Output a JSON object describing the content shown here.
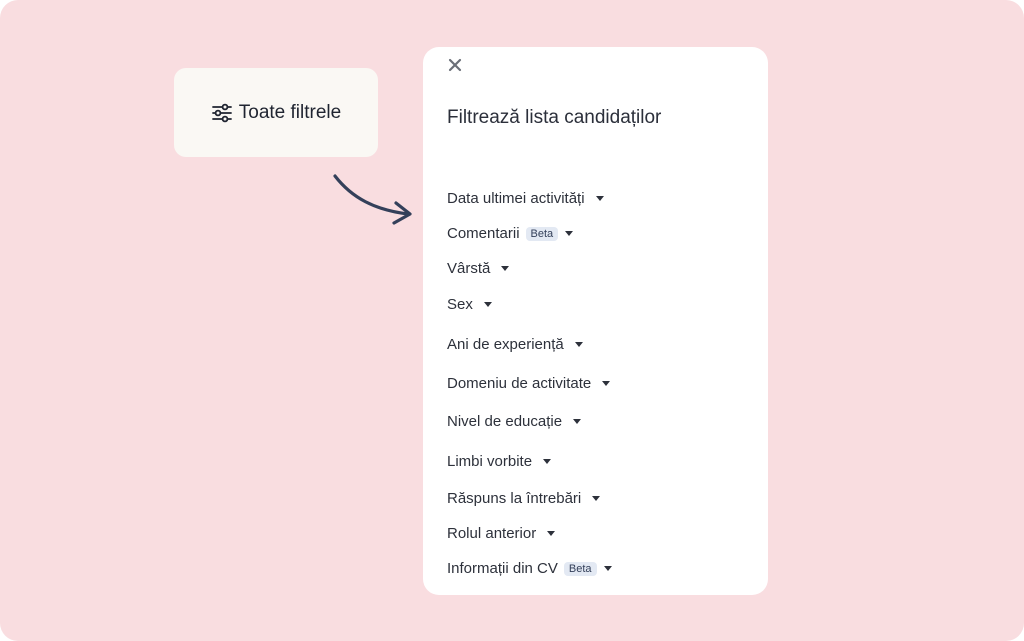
{
  "trigger": {
    "icon": "sliders-icon",
    "label": "Toate filtrele"
  },
  "panel": {
    "close_icon": "close-icon",
    "title": "Filtrează lista candidaților",
    "filters": [
      {
        "label": "Data ultimei activități",
        "badge": ""
      },
      {
        "label": "Comentarii",
        "badge": "Beta"
      },
      {
        "label": "Vârstă",
        "badge": ""
      },
      {
        "label": "Sex",
        "badge": ""
      },
      {
        "label": "Ani de experiență",
        "badge": ""
      },
      {
        "label": "Domeniu de activitate",
        "badge": ""
      },
      {
        "label": "Nivel de educație",
        "badge": ""
      },
      {
        "label": "Limbi vorbite",
        "badge": ""
      },
      {
        "label": "Răspuns la întrebări",
        "badge": ""
      },
      {
        "label": "Rolul anterior",
        "badge": ""
      },
      {
        "label": "Informații din CV",
        "badge": "Beta"
      }
    ]
  },
  "colors": {
    "background": "#f9dde0",
    "panel": "#ffffff",
    "trigger": "#faf8f4",
    "arrow": "#34405a",
    "badge": "#e3e9f3"
  }
}
